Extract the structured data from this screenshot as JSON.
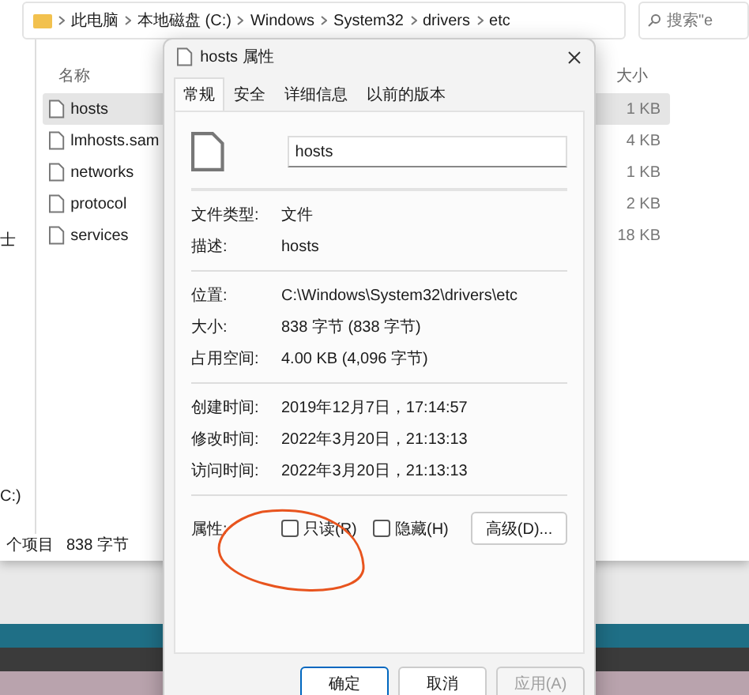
{
  "explorer": {
    "breadcrumbs": [
      "此电脑",
      "本地磁盘 (C:)",
      "Windows",
      "System32",
      "drivers",
      "etc"
    ],
    "search": {
      "placeholder": "搜索\"e"
    },
    "nav_fragments": [
      "士",
      "C:)"
    ],
    "columns": [
      "名称",
      "大小"
    ],
    "files": [
      {
        "name": "hosts",
        "size": "1 KB",
        "selected": true
      },
      {
        "name": "lmhosts.sam",
        "size": "4 KB",
        "selected": false
      },
      {
        "name": "networks",
        "size": "1 KB",
        "selected": false
      },
      {
        "name": "protocol",
        "size": "2 KB",
        "selected": false
      },
      {
        "name": "services",
        "size": "18 KB",
        "selected": false
      }
    ],
    "status": [
      "个项目",
      "838 字节"
    ]
  },
  "dialog": {
    "title": "hosts 属性",
    "tabs": [
      {
        "label": "常规",
        "selected": true
      },
      {
        "label": "安全",
        "selected": false
      },
      {
        "label": "详细信息",
        "selected": false
      },
      {
        "label": "以前的版本",
        "selected": false
      }
    ],
    "file_name": "hosts",
    "groups": [
      [
        {
          "label": "文件类型:",
          "value": "文件"
        },
        {
          "label": "描述:",
          "value": "hosts"
        }
      ],
      [
        {
          "label": "位置:",
          "value": "C:\\Windows\\System32\\drivers\\etc"
        },
        {
          "label": "大小:",
          "value": "838 字节 (838 字节)"
        },
        {
          "label": "占用空间:",
          "value": "4.00 KB (4,096 字节)"
        }
      ],
      [
        {
          "label": "创建时间:",
          "value": "2019年12月7日，17:14:57"
        },
        {
          "label": "修改时间:",
          "value": "2022年3月20日，21:13:13"
        },
        {
          "label": "访问时间:",
          "value": "2022年3月20日，21:13:13"
        }
      ]
    ],
    "attributes_label": "属性:",
    "attributes": [
      {
        "label": "只读(R)",
        "checked": false
      },
      {
        "label": "隐藏(H)",
        "checked": false
      }
    ],
    "advanced_button": "高级(D)...",
    "buttons": [
      {
        "label": "确定",
        "kind": "default",
        "disabled": false
      },
      {
        "label": "取消",
        "kind": "normal",
        "disabled": false
      },
      {
        "label": "应用(A)",
        "kind": "normal",
        "disabled": true
      }
    ]
  }
}
